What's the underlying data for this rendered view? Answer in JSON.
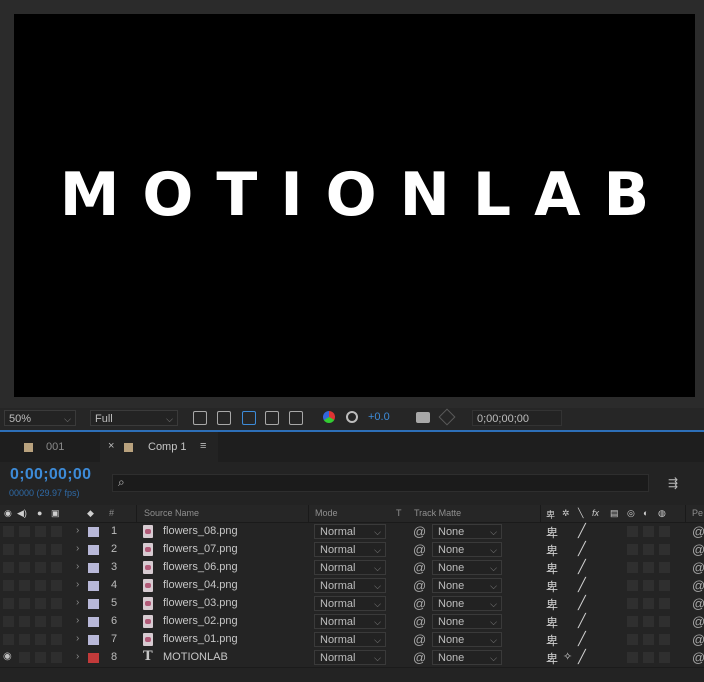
{
  "viewer": {
    "composition_text": "MOTIONLAB"
  },
  "viewer_toolbar": {
    "zoom": "50%",
    "resolution": "Full",
    "exposure": "+0.0",
    "timecode": "0;00;00;00"
  },
  "tabs": [
    {
      "label": "001",
      "active": false
    },
    {
      "label": "Comp 1",
      "active": true,
      "close": "×",
      "menu": "≡"
    }
  ],
  "timeline": {
    "current_time": "0;00;00;00",
    "frame_info": "00000 (29.97 fps)",
    "search_icon_glyph": "⌕",
    "columns": {
      "number": "#",
      "source_name": "Source Name",
      "mode": "Mode",
      "t": "T",
      "track_matte": "Track Matte",
      "parent_abbrev": "Pe"
    },
    "layers": [
      {
        "num": "1",
        "name": "flowers_08.png",
        "mode": "Normal",
        "matte": "None",
        "type": "image",
        "label_color": "#b8b8d8",
        "visible": false
      },
      {
        "num": "2",
        "name": "flowers_07.png",
        "mode": "Normal",
        "matte": "None",
        "type": "image",
        "label_color": "#b8b8d8",
        "visible": false
      },
      {
        "num": "3",
        "name": "flowers_06.png",
        "mode": "Normal",
        "matte": "None",
        "type": "image",
        "label_color": "#b8b8d8",
        "visible": false
      },
      {
        "num": "4",
        "name": "flowers_04.png",
        "mode": "Normal",
        "matte": "None",
        "type": "image",
        "label_color": "#b8b8d8",
        "visible": false
      },
      {
        "num": "5",
        "name": "flowers_03.png",
        "mode": "Normal",
        "matte": "None",
        "type": "image",
        "label_color": "#b8b8d8",
        "visible": false
      },
      {
        "num": "6",
        "name": "flowers_02.png",
        "mode": "Normal",
        "matte": "None",
        "type": "image",
        "label_color": "#b8b8d8",
        "visible": false
      },
      {
        "num": "7",
        "name": "flowers_01.png",
        "mode": "Normal",
        "matte": "None",
        "type": "image",
        "label_color": "#b8b8d8",
        "visible": false
      },
      {
        "num": "8",
        "name": "MOTIONLAB",
        "mode": "Normal",
        "matte": "None",
        "type": "text",
        "label_color": "#c23a3a",
        "visible": true
      }
    ]
  },
  "colors": {
    "accent_blue": "#3d8bd8",
    "viewer_bg": "#000000",
    "panel_bg": "#232323"
  }
}
